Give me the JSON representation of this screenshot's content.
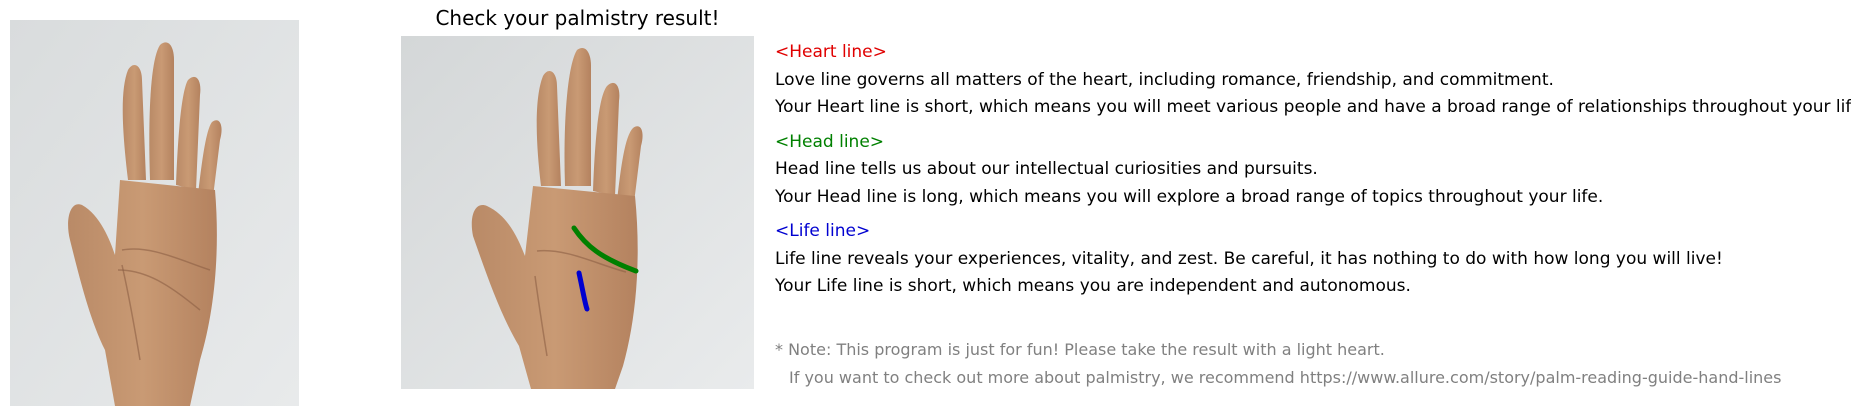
{
  "title": "Check your palmistry result!",
  "sections": [
    {
      "label": "<Heart line>",
      "color": "#e00000",
      "lines": [
        "Love line governs all matters of the heart, including romance, friendship, and commitment.",
        "Your Heart line is short, which means you will meet various people and have a broad range of relationships throughout your life."
      ]
    },
    {
      "label": "<Head line>",
      "color": "#008000",
      "lines": [
        "Head line tells us about our intellectual curiosities and pursuits.",
        "Your Head line is long, which means you will explore a broad range of topics throughout your life."
      ]
    },
    {
      "label": "<Life line>",
      "color": "#0000d0",
      "lines": [
        "Life line reveals your experiences, vitality, and zest. Be careful, it has nothing to do with how long you will live!",
        "Your Life line is short, which means you are independent and autonomous."
      ]
    }
  ],
  "note": {
    "line1": "* Note: This program is just for fun! Please take the result with a light heart.",
    "line2": "If you want to check out more about palmistry, we recommend https://www.allure.com/story/palm-reading-guide-hand-lines"
  },
  "overlay_colors": {
    "head_line": "#008000",
    "life_line": "#0000d0"
  }
}
